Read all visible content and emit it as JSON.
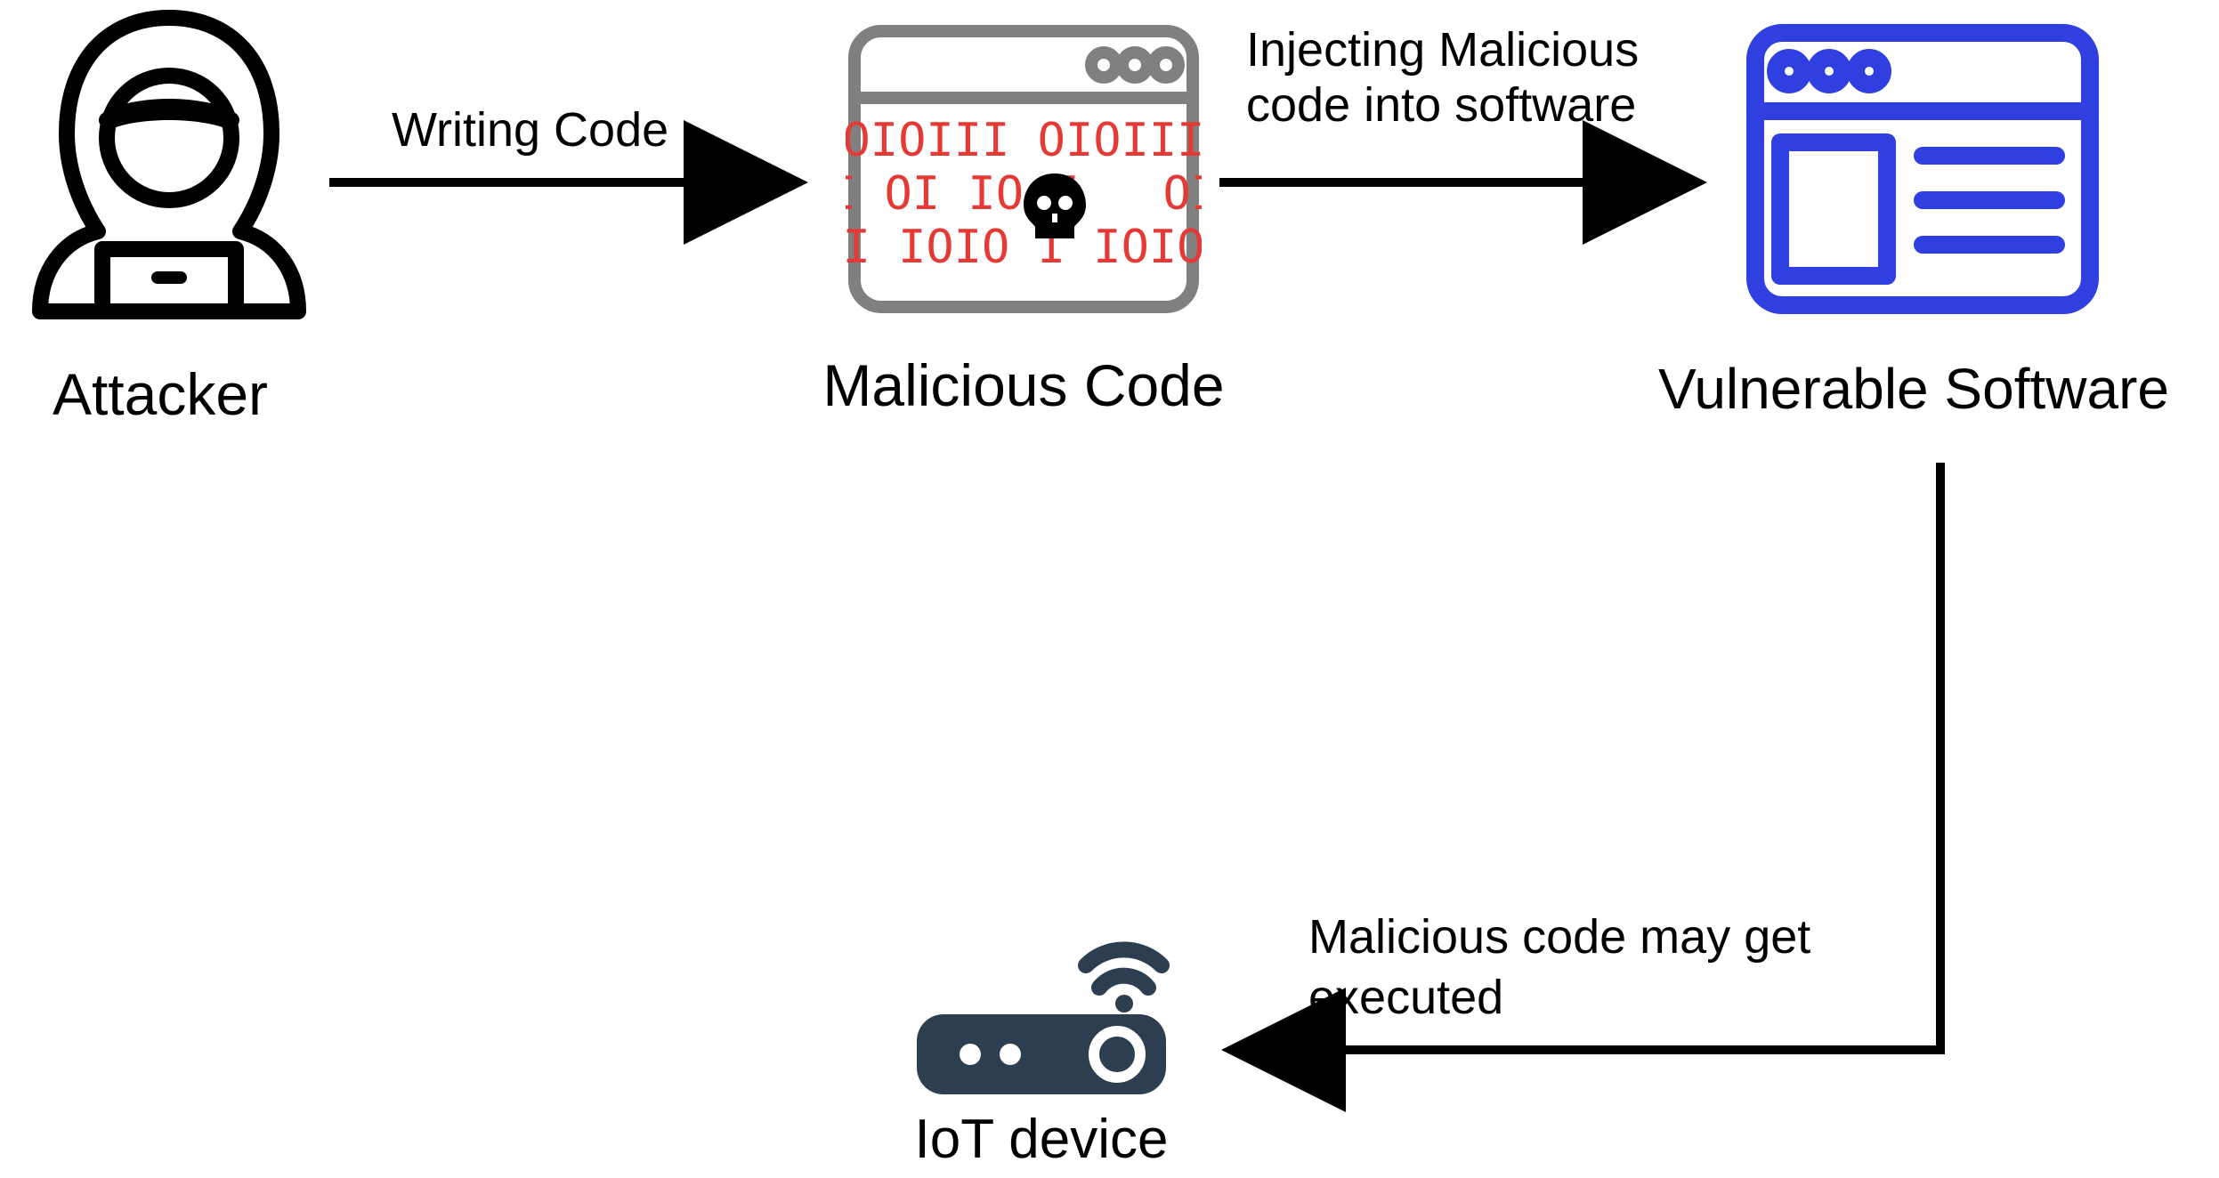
{
  "nodes": {
    "attacker": {
      "label": "Attacker"
    },
    "malicious": {
      "label": "Malicious Code",
      "binary": [
        "OIOIII OIOIII",
        "I I OI IO I   OI I",
        "I IOIO I IOIO"
      ]
    },
    "vulnerable": {
      "label": "Vulnerable Software"
    },
    "iot": {
      "label": "IoT device"
    }
  },
  "edges": {
    "writing": {
      "label": "Writing Code"
    },
    "injecting": {
      "label": "Injecting Malicious\ncode into software"
    },
    "executed": {
      "label": "Malicious code may get\nexecuted"
    }
  },
  "colors": {
    "black": "#000000",
    "gray": "#808080",
    "red": "#E53935",
    "blue": "#2F3FE0",
    "dark": "#2C3E50"
  }
}
